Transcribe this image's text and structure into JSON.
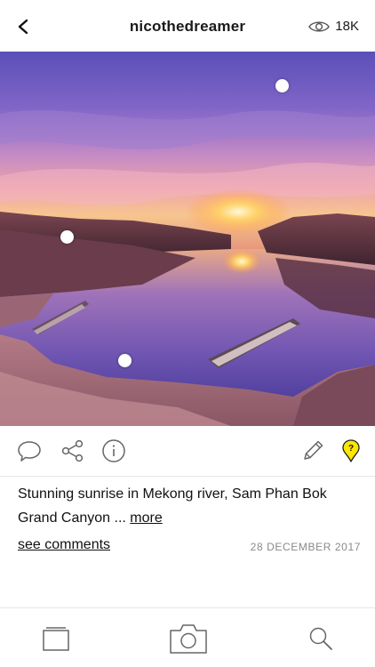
{
  "header": {
    "title": "nicothedreamer",
    "views_count": "18K",
    "back_icon": "chevron-left-icon",
    "views_icon": "eye-icon"
  },
  "photo": {
    "description_icon": "photo"
  },
  "actions": {
    "icons": [
      "comment-icon",
      "share-icon",
      "info-icon",
      "edit-icon",
      "question-tag-icon"
    ],
    "accent": "#ffe600"
  },
  "post": {
    "caption": "Stunning sunrise in Mekong river, Sam Phan Bok Grand Canyon ... ",
    "more_label": "more",
    "comments_label": "see comments",
    "date": "28 DECEMBER 2017"
  },
  "tabbar": {
    "icons": [
      "gallery-icon",
      "camera-icon",
      "search-icon"
    ]
  }
}
